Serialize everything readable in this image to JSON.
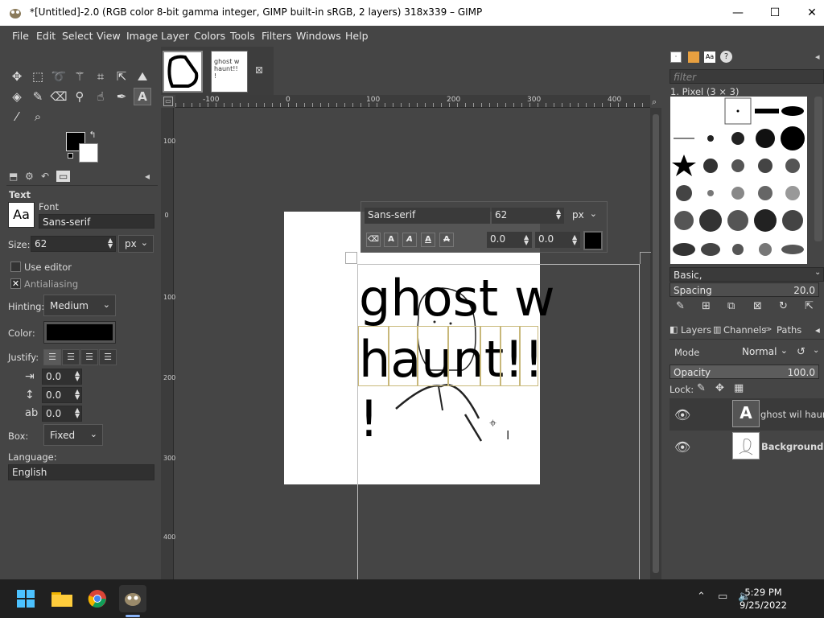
{
  "window": {
    "title": "*[Untitled]-2.0 (RGB color 8-bit gamma integer, GIMP built-in sRGB, 2 layers) 318x339 – GIMP",
    "minimize": "—",
    "maximize": "☐",
    "close": "✕"
  },
  "menu": [
    "File",
    "Edit",
    "Select",
    "View",
    "Image",
    "Layer",
    "Colors",
    "Tools",
    "Filters",
    "Windows",
    "Help"
  ],
  "tool_options": {
    "section_title": "Text",
    "font_label": "Font",
    "font_preview": "Aa",
    "font_value": "Sans-serif",
    "size_label": "Size:",
    "size_value": "62",
    "size_unit": "px",
    "use_editor_label": "Use editor",
    "use_editor_checked": false,
    "antialiasing_label": "Antialiasing",
    "antialiasing_checked": true,
    "hinting_label": "Hinting:",
    "hinting_value": "Medium",
    "color_label": "Color:",
    "color_value": "#000000",
    "justify_label": "Justify:",
    "indent_value": "0.0",
    "line_spacing_value": "0.0",
    "letter_spacing_value": "0.0",
    "box_label": "Box:",
    "box_value": "Fixed",
    "language_label": "Language:",
    "language_value": "English"
  },
  "ruler": {
    "h_labels": [
      "-100",
      "0",
      "100",
      "200",
      "300",
      "400"
    ],
    "v_labels": [
      "100",
      "0",
      "100",
      "200",
      "300",
      "400"
    ]
  },
  "text_overlay": {
    "font": "Sans-serif",
    "size": "62",
    "unit": "px",
    "baseline": "0.0",
    "kerning": "0.0",
    "color": "#000000"
  },
  "canvas_text": {
    "line1": "ghost w",
    "line2": "haunt!!",
    "line3": "!"
  },
  "brushes": {
    "filter_placeholder": "filter",
    "selected_name": "1. Pixel (3 × 3)",
    "tag": "Basic,",
    "spacing_label": "Spacing",
    "spacing_value": "20.0"
  },
  "layers_panel": {
    "tabs": [
      "Layers",
      "Channels",
      "Paths"
    ],
    "mode_label": "Mode",
    "mode_value": "Normal",
    "opacity_label": "Opacity",
    "opacity_value": "100.0",
    "lock_label": "Lock:",
    "layers": [
      {
        "name": "ghost wil haunt!",
        "bold": false,
        "visible": true
      },
      {
        "name": "Background",
        "bold": true,
        "visible": true
      }
    ]
  },
  "taskbar": {
    "time": "5:29 PM",
    "date": "9/25/2022"
  },
  "colors": {
    "bg": "#454545",
    "foreground": "#000000",
    "background": "#ffffff",
    "taskbar": "#202020"
  }
}
